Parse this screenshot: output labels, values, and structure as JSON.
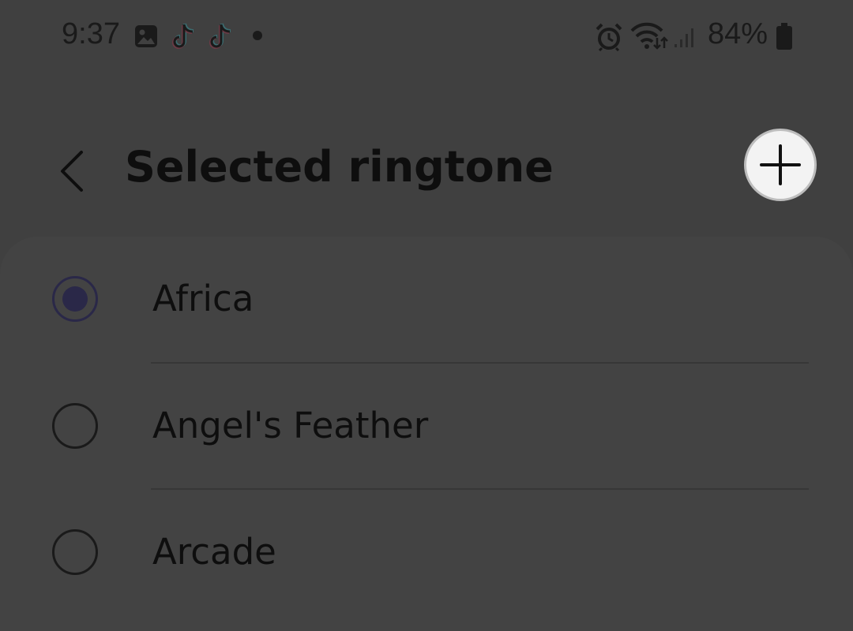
{
  "status_bar": {
    "time": "9:37",
    "left_icons": [
      "image-icon",
      "tiktok-icon",
      "tiktok-icon",
      "dot-icon"
    ],
    "right_icons": [
      "alarm-icon",
      "wifi-icon",
      "signal-icon",
      "battery-icon"
    ],
    "battery_percent": "84%"
  },
  "header": {
    "title": "Selected ringtone",
    "back_icon": "chevron-left-icon",
    "add_icon": "plus-icon"
  },
  "ringtones": [
    {
      "label": "Africa",
      "selected": true
    },
    {
      "label": "Angel's Feather",
      "selected": false
    },
    {
      "label": "Arcade",
      "selected": false
    }
  ],
  "colors": {
    "background": "#404040",
    "radio_selected": "#2a2848",
    "add_button_bg": "#f3f3f3"
  }
}
